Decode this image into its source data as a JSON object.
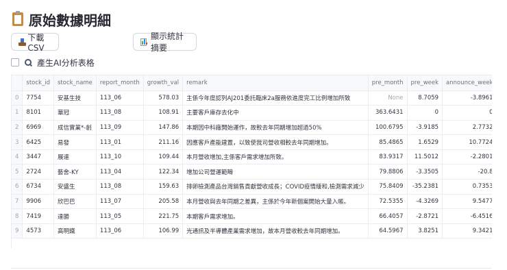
{
  "page": {
    "title": "原始數據明細"
  },
  "toolbar": {
    "download_label": "下載 CSV",
    "stats_label": "顯示統計摘要"
  },
  "options": {
    "ai_table_label": "產生AI分析表格",
    "ai_table_checked": false
  },
  "table": {
    "columns": [
      "",
      "stock_id",
      "stock_name",
      "report_month",
      "growth_val",
      "remark",
      "pre_month",
      "pre_week",
      "announce_week",
      "a"
    ],
    "rows": [
      {
        "index": "0",
        "stock_id": "7754",
        "stock_name": "安基生技",
        "report_month": "113_06",
        "growth_val": "578.03",
        "remark": "主係今年度認列AJ201委託臨床2a服務依進度完工比例增加所致",
        "pre_month": "None",
        "pre_week": "8.7059",
        "announce_week": "-3.8961"
      },
      {
        "index": "1",
        "stock_id": "8101",
        "stock_name": "華冠",
        "report_month": "113_08",
        "growth_val": "108.91",
        "remark": "主要客戶庫存去化中",
        "pre_month": "363.6431",
        "pre_week": "0",
        "announce_week": "0"
      },
      {
        "index": "2",
        "stock_id": "6969",
        "stock_name": "成信實業*-創",
        "report_month": "113_09",
        "growth_val": "147.86",
        "remark": "本期因中科廠開始運作，故較去年同期增加超過50%",
        "pre_month": "100.6795",
        "pre_week": "-3.9185",
        "announce_week": "2.7732"
      },
      {
        "index": "3",
        "stock_id": "6425",
        "stock_name": "易發",
        "report_month": "113_01",
        "growth_val": "211.16",
        "remark": "因應客戶產能建置，以致使我司營收相較去年同期增加。",
        "pre_month": "85.4865",
        "pre_week": "1.6529",
        "announce_week": "10.7724"
      },
      {
        "index": "4",
        "stock_id": "3447",
        "stock_name": "展達",
        "report_month": "113_10",
        "growth_val": "109.44",
        "remark": "本月營收增加,主係客戶需求增加所致。",
        "pre_month": "83.9317",
        "pre_week": "11.5012",
        "announce_week": "-2.2801"
      },
      {
        "index": "5",
        "stock_id": "2724",
        "stock_name": "藝舍-KY",
        "report_month": "113_04",
        "growth_val": "122.34",
        "remark": "增加公司營運範疇",
        "pre_month": "79.8806",
        "pre_week": "-3.3505",
        "announce_week": "-20.8"
      },
      {
        "index": "6",
        "stock_id": "6734",
        "stock_name": "安盛生",
        "report_month": "113_08",
        "growth_val": "159.63",
        "remark": "排卵檢測產品台灣銷售貢獻營收成長；COVID疫情緩和,檢測需求減少",
        "pre_month": "75.8409",
        "pre_week": "-35.2381",
        "announce_week": "0.7353"
      },
      {
        "index": "7",
        "stock_id": "9906",
        "stock_name": "欣巴巴",
        "report_month": "113_07",
        "growth_val": "205.58",
        "remark": "本月營收與去年同期之差異，主係於今年新個案開始大量入帳。",
        "pre_month": "72.5355",
        "pre_week": "-4.3269",
        "announce_week": "9.5477"
      },
      {
        "index": "8",
        "stock_id": "7419",
        "stock_name": "達勝",
        "report_month": "113_05",
        "growth_val": "221.75",
        "remark": "本期客戶需求增加。",
        "pre_month": "66.4057",
        "pre_week": "-2.8721",
        "announce_week": "-6.4516"
      },
      {
        "index": "9",
        "stock_id": "4573",
        "stock_name": "高明鐵",
        "report_month": "113_06",
        "growth_val": "106.99",
        "remark": "光通訊及半導體產業需求增加，故本月營收較去年同期增加。",
        "pre_month": "64.5967",
        "pre_week": "3.8251",
        "announce_week": "9.3421"
      }
    ]
  },
  "colors": {
    "header_bg": "#f8f9fb",
    "grid_line": "#ececef",
    "muted": "#a2a6ae"
  },
  "icons": {
    "title": "clipboard-icon",
    "download": "inbox-tray-icon",
    "stats": "bar-chart-icon",
    "ai": "magnifier-icon"
  }
}
